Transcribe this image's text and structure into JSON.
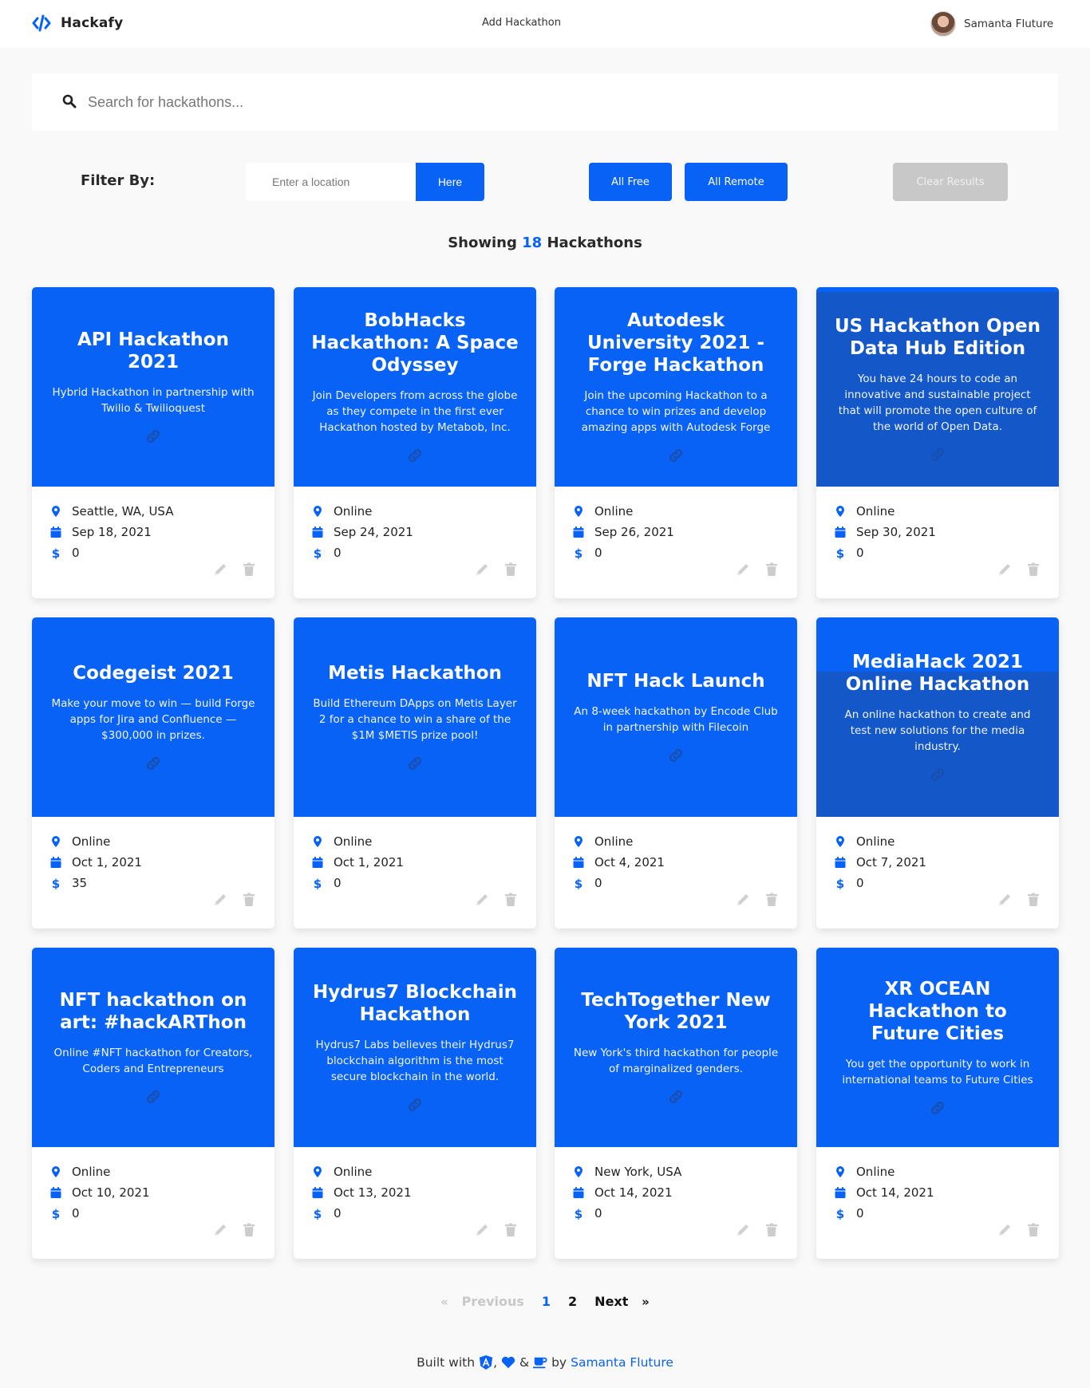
{
  "navbar": {
    "brand_name": "Hackafy",
    "brand_icon": "code-icon",
    "add_link": "Add Hackathon",
    "user_name": "Samanta Fluture"
  },
  "search": {
    "placeholder": "Search for hackathons...",
    "value": ""
  },
  "filters": {
    "label": "Filter By:",
    "location_placeholder": "Enter a location",
    "location_value": "",
    "here_button": "Here",
    "all_free_button": "All Free",
    "all_remote_button": "All Remote",
    "clear_button": "Clear Results"
  },
  "results": {
    "prefix": "Showing",
    "count": "18",
    "suffix": "Hackathons"
  },
  "colors": {
    "accent": "#0762f5",
    "accent_dark": "#1457c9",
    "disabled": "#c8c8c8",
    "background": "#f9f9f9"
  },
  "hackathons": [
    {
      "title": "API Hackathon 2021",
      "description": "Hybrid Hackathon in partnership with Twilio & Twilioquest",
      "location": "Seattle, WA, USA",
      "date": "Sep 18, 2021",
      "price": "0"
    },
    {
      "title": "BobHacks Hackathon: A Space Odyssey",
      "description": "Join Developers from across the globe as they compete in the first ever Hackathon hosted by Metabob, Inc.",
      "location": "Online",
      "date": "Sep 24, 2021",
      "price": "0"
    },
    {
      "title": "Autodesk University 2021 - Forge Hackathon",
      "description": "Join the upcoming Hackathon to a chance to win prizes and develop amazing apps with Autodesk Forge",
      "location": "Online",
      "date": "Sep 26, 2021",
      "price": "0"
    },
    {
      "title": "US Hackathon Open Data Hub Edition",
      "description": "You have 24 hours to code an innovative and sustainable project that will promote the open culture of the world of Open Data.",
      "location": "Online",
      "date": "Sep 30, 2021",
      "price": "0"
    },
    {
      "title": "Codegeist 2021",
      "description": "Make your move to win — build Forge apps for Jira and Confluence — $300,000 in prizes.",
      "location": "Online",
      "date": "Oct 1, 2021",
      "price": "35"
    },
    {
      "title": "Metis Hackathon",
      "description": "Build Ethereum DApps on Metis Layer 2 for a chance to win a share of the $1M $METIS prize pool!",
      "location": "Online",
      "date": "Oct 1, 2021",
      "price": "0"
    },
    {
      "title": "NFT Hack Launch",
      "description": "An 8-week hackathon by Encode Club in partnership with Filecoin",
      "location": "Online",
      "date": "Oct 4, 2021",
      "price": "0"
    },
    {
      "title": "MediaHack 2021 Online Hackathon",
      "description": "An online hackathon to create and test new solutions for the media industry.",
      "location": "Online",
      "date": "Oct 7, 2021",
      "price": "0"
    },
    {
      "title": "NFT hackathon on art: #hackARThon",
      "description": "Online #NFT hackathon for Creators, Coders and Entrepreneurs",
      "location": "Online",
      "date": "Oct 10, 2021",
      "price": "0"
    },
    {
      "title": "Hydrus7 Blockchain Hackathon",
      "description": "Hydrus7 Labs believes their Hydrus7 blockchain algorithm is the most secure blockchain in the world.",
      "location": "Online",
      "date": "Oct 13, 2021",
      "price": "0"
    },
    {
      "title": "TechTogether New York 2021",
      "description": "New York's third hackathon for people of marginalized genders.",
      "location": "New York, USA",
      "date": "Oct 14, 2021",
      "price": "0"
    },
    {
      "title": "XR OCEAN Hackathon to Future Cities",
      "description": "You get the opportunity to work in international teams to Future Cities",
      "location": "Online",
      "date": "Oct 14, 2021",
      "price": "0"
    }
  ],
  "pagination": {
    "prev_arrow": "«",
    "previous": "Previous",
    "pages": [
      "1",
      "2"
    ],
    "current_page": "1",
    "next": "Next",
    "next_arrow": "»"
  },
  "footer": {
    "built_with": "Built with",
    "comma": ",",
    "ampersand": "&",
    "by": "by",
    "author": "Samanta Fluture",
    "icons": [
      "angular-icon",
      "heart-icon",
      "coffee-icon"
    ]
  }
}
